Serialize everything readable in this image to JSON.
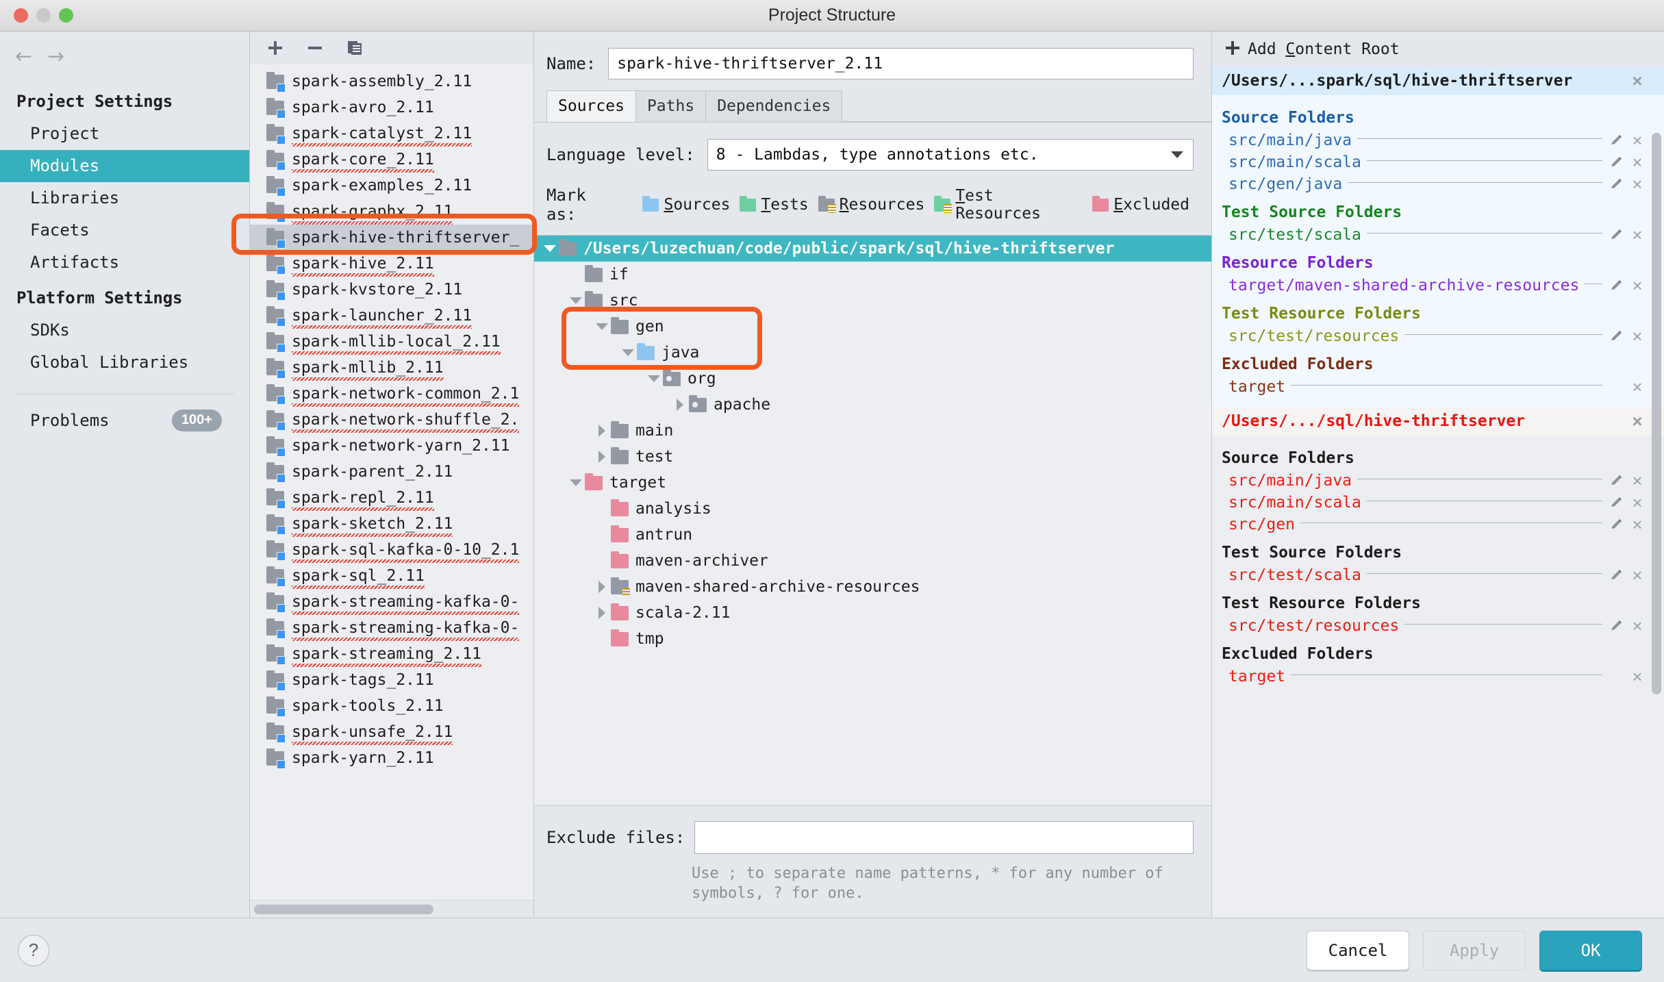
{
  "window": {
    "title": "Project Structure"
  },
  "sidebar": {
    "nav": {
      "back": "←",
      "forward": "→"
    },
    "groups": [
      {
        "title": "Project Settings",
        "items": [
          {
            "label": "Project",
            "selected": false
          },
          {
            "label": "Modules",
            "selected": true
          },
          {
            "label": "Libraries",
            "selected": false
          },
          {
            "label": "Facets",
            "selected": false
          },
          {
            "label": "Artifacts",
            "selected": false
          }
        ]
      },
      {
        "title": "Platform Settings",
        "items": [
          {
            "label": "SDKs",
            "selected": false
          },
          {
            "label": "Global Libraries",
            "selected": false
          }
        ]
      }
    ],
    "problems": {
      "label": "Problems",
      "count": "100+"
    }
  },
  "modules_panel": {
    "toolbar": {
      "add": "+",
      "remove": "−",
      "copy": "copy-icon"
    },
    "items": [
      {
        "name": "spark-assembly_2.11",
        "spell": false,
        "selected": false
      },
      {
        "name": "spark-avro_2.11",
        "spell": false,
        "selected": false
      },
      {
        "name": "spark-catalyst_2.11",
        "spell": true,
        "selected": false
      },
      {
        "name": "spark-core_2.11",
        "spell": true,
        "selected": false
      },
      {
        "name": "spark-examples_2.11",
        "spell": false,
        "selected": false
      },
      {
        "name": "spark-graphx_2.11",
        "spell": true,
        "selected": false
      },
      {
        "name": "spark-hive-thriftserver_",
        "spell": false,
        "selected": true
      },
      {
        "name": "spark-hive_2.11",
        "spell": true,
        "selected": false
      },
      {
        "name": "spark-kvstore_2.11",
        "spell": false,
        "selected": false
      },
      {
        "name": "spark-launcher_2.11",
        "spell": true,
        "selected": false
      },
      {
        "name": "spark-mllib-local_2.11",
        "spell": true,
        "selected": false
      },
      {
        "name": "spark-mllib_2.11",
        "spell": true,
        "selected": false
      },
      {
        "name": "spark-network-common_2.1",
        "spell": true,
        "selected": false
      },
      {
        "name": "spark-network-shuffle_2.",
        "spell": true,
        "selected": false
      },
      {
        "name": "spark-network-yarn_2.11",
        "spell": false,
        "selected": false
      },
      {
        "name": "spark-parent_2.11",
        "spell": false,
        "selected": false
      },
      {
        "name": "spark-repl_2.11",
        "spell": true,
        "selected": false
      },
      {
        "name": "spark-sketch_2.11",
        "spell": true,
        "selected": false
      },
      {
        "name": "spark-sql-kafka-0-10_2.1",
        "spell": true,
        "selected": false
      },
      {
        "name": "spark-sql_2.11",
        "spell": true,
        "selected": false
      },
      {
        "name": "spark-streaming-kafka-0-",
        "spell": true,
        "selected": false
      },
      {
        "name": "spark-streaming-kafka-0-",
        "spell": true,
        "selected": false
      },
      {
        "name": "spark-streaming_2.11",
        "spell": true,
        "selected": false
      },
      {
        "name": "spark-tags_2.11",
        "spell": false,
        "selected": false
      },
      {
        "name": "spark-tools_2.11",
        "spell": false,
        "selected": false
      },
      {
        "name": "spark-unsafe_2.11",
        "spell": true,
        "selected": false
      },
      {
        "name": "spark-yarn_2.11",
        "spell": false,
        "selected": false
      }
    ]
  },
  "center": {
    "name_label": "Name:",
    "name_value": "spark-hive-thriftserver_2.11",
    "tabs": [
      {
        "label": "Sources",
        "active": true
      },
      {
        "label": "Paths",
        "active": false
      },
      {
        "label": "Dependencies",
        "active": false
      }
    ],
    "language_level_label": "Language level:",
    "language_level_value": "8 - Lambdas, type annotations etc.",
    "mark_as_label": "Mark as:",
    "mark_as": [
      {
        "label": "Sources",
        "mnemonic": "S",
        "color": "#8ec5f0",
        "stripes": false
      },
      {
        "label": "Tests",
        "mnemonic": "T",
        "color": "#6ecfa0",
        "stripes": false
      },
      {
        "label": "Resources",
        "mnemonic": "R",
        "color": "#9299a3",
        "stripes": true
      },
      {
        "label": "Test Resources",
        "mnemonic": "T",
        "color": "#6ecfa0",
        "stripes": true
      },
      {
        "label": "Excluded",
        "mnemonic": "E",
        "color": "#e8899d",
        "stripes": false
      }
    ],
    "tree": [
      {
        "label": "/Users/luzechuan/code/public/spark/sql/hive-thriftserver",
        "indent": 0,
        "toggle": "down",
        "icon": "folder",
        "color": "#9299a3",
        "selected": true
      },
      {
        "label": "if",
        "indent": 1,
        "toggle": "none",
        "icon": "folder",
        "color": "#9299a3",
        "selected": false
      },
      {
        "label": "src",
        "indent": 1,
        "toggle": "down",
        "icon": "folder",
        "color": "#9299a3",
        "selected": false
      },
      {
        "label": "gen",
        "indent": 2,
        "toggle": "down",
        "icon": "folder",
        "color": "#9299a3",
        "selected": false
      },
      {
        "label": "java",
        "indent": 3,
        "toggle": "down",
        "icon": "folder",
        "color": "#8ec5f0",
        "selected": false
      },
      {
        "label": "org",
        "indent": 4,
        "toggle": "down",
        "icon": "package",
        "color": "#9299a3",
        "selected": false
      },
      {
        "label": "apache",
        "indent": 5,
        "toggle": "right",
        "icon": "package",
        "color": "#9299a3",
        "selected": false
      },
      {
        "label": "main",
        "indent": 2,
        "toggle": "right",
        "icon": "folder",
        "color": "#9299a3",
        "selected": false
      },
      {
        "label": "test",
        "indent": 2,
        "toggle": "right",
        "icon": "folder",
        "color": "#9299a3",
        "selected": false
      },
      {
        "label": "target",
        "indent": 1,
        "toggle": "down",
        "icon": "folder",
        "color": "#e8899d",
        "selected": false
      },
      {
        "label": "analysis",
        "indent": 2,
        "toggle": "none",
        "icon": "folder",
        "color": "#e8899d",
        "selected": false
      },
      {
        "label": "antrun",
        "indent": 2,
        "toggle": "none",
        "icon": "folder",
        "color": "#e8899d",
        "selected": false
      },
      {
        "label": "maven-archiver",
        "indent": 2,
        "toggle": "none",
        "icon": "folder",
        "color": "#e8899d",
        "selected": false
      },
      {
        "label": "maven-shared-archive-resources",
        "indent": 2,
        "toggle": "right",
        "icon": "resource",
        "color": "#9299a3",
        "selected": false
      },
      {
        "label": "scala-2.11",
        "indent": 2,
        "toggle": "right",
        "icon": "folder",
        "color": "#e8899d",
        "selected": false
      },
      {
        "label": "tmp",
        "indent": 2,
        "toggle": "none",
        "icon": "folder",
        "color": "#e8899d",
        "selected": false
      }
    ],
    "exclude_label": "Exclude files:",
    "exclude_value": "",
    "exclude_hint": "Use ; to separate name patterns, * for any number of symbols, ? for one."
  },
  "right_panel": {
    "add_content_root": "Add Content Root",
    "add_content_root_mnemonic": "C",
    "roots": [
      {
        "path": "/Users/...spark/sql/hive-thriftserver",
        "style": "blue",
        "sections": [
          {
            "title": "Source Folders",
            "title_color": "#1b5ea8",
            "item_color": "#2f6cb5",
            "items": [
              {
                "path": "src/main/java",
                "pencil": true,
                "close": true
              },
              {
                "path": "src/main/scala",
                "pencil": true,
                "close": true
              },
              {
                "path": "src/gen/java",
                "pencil": true,
                "close": true
              }
            ]
          },
          {
            "title": "Test Source Folders",
            "title_color": "#15851f",
            "item_color": "#18892b",
            "items": [
              {
                "path": "src/test/scala",
                "pencil": true,
                "close": true
              }
            ]
          },
          {
            "title": "Resource Folders",
            "title_color": "#7a23d6",
            "item_color": "#8b2ae0",
            "items": [
              {
                "path": "target/maven-shared-archive-resources",
                "pencil": true,
                "close": true
              }
            ]
          },
          {
            "title": "Test Resource Folders",
            "title_color": "#7a8a10",
            "item_color": "#87961a",
            "items": [
              {
                "path": "src/test/resources",
                "pencil": true,
                "close": true
              }
            ]
          },
          {
            "title": "Excluded Folders",
            "title_color": "#7d2a12",
            "item_color": "#8a3418",
            "items": [
              {
                "path": "target",
                "pencil": false,
                "close": true
              }
            ]
          }
        ]
      },
      {
        "path": "/Users/.../sql/hive-thriftserver",
        "style": "red",
        "sections": [
          {
            "title": "Source Folders",
            "title_color": "#1d1d1d",
            "item_color": "#ef1c12",
            "items": [
              {
                "path": "src/main/java",
                "pencil": true,
                "close": true
              },
              {
                "path": "src/main/scala",
                "pencil": true,
                "close": true
              },
              {
                "path": "src/gen",
                "pencil": true,
                "close": true
              }
            ]
          },
          {
            "title": "Test Source Folders",
            "title_color": "#1d1d1d",
            "item_color": "#ef1c12",
            "items": [
              {
                "path": "src/test/scala",
                "pencil": true,
                "close": true
              }
            ]
          },
          {
            "title": "Test Resource Folders",
            "title_color": "#1d1d1d",
            "item_color": "#ef1c12",
            "items": [
              {
                "path": "src/test/resources",
                "pencil": true,
                "close": true
              }
            ]
          },
          {
            "title": "Excluded Folders",
            "title_color": "#1d1d1d",
            "item_color": "#ef1c12",
            "items": [
              {
                "path": "target",
                "pencil": false,
                "close": true
              }
            ]
          }
        ]
      }
    ]
  },
  "footer": {
    "help": "?",
    "cancel": "Cancel",
    "apply": "Apply",
    "ok": "OK"
  },
  "annotations": {
    "accent": "#ef5a22",
    "boxes": [
      {
        "name": "module-highlight"
      },
      {
        "name": "gen-java-highlight"
      }
    ]
  }
}
